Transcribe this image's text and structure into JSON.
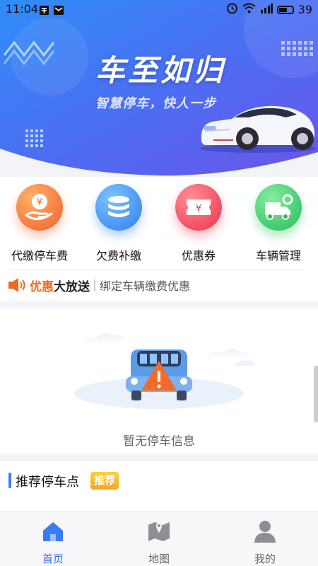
{
  "status_bar": {
    "time": "11:04",
    "battery": "39"
  },
  "hero": {
    "title": "车至如归",
    "subtitle": "智慧停车，快人一步"
  },
  "functions": [
    {
      "label": "代缴停车费",
      "icon": "hand-coin-icon",
      "color": "#f47a3a"
    },
    {
      "label": "欠费补缴",
      "icon": "stack-icon",
      "color": "#3a8ff6"
    },
    {
      "label": "优惠券",
      "icon": "coupon-icon",
      "color": "#f2475b"
    },
    {
      "label": "车辆管理",
      "icon": "truck-gear-icon",
      "color": "#35c86a"
    }
  ],
  "promo": {
    "tag_part1": "优惠",
    "tag_part2": "大放送",
    "text": "绑定车辆缴费优惠"
  },
  "empty_state": {
    "text": "暂无停车信息"
  },
  "recommend": {
    "title": "推荐停车点",
    "badge": "推荐"
  },
  "tabs": [
    {
      "label": "首页",
      "icon": "home-icon",
      "active": true
    },
    {
      "label": "地图",
      "icon": "map-pin-icon",
      "active": false
    },
    {
      "label": "我的",
      "icon": "user-icon",
      "active": false
    }
  ],
  "colors": {
    "accent": "#2f6ef0",
    "hero_top": "#3a6cf3",
    "hero_bottom": "#5b5ae9"
  }
}
